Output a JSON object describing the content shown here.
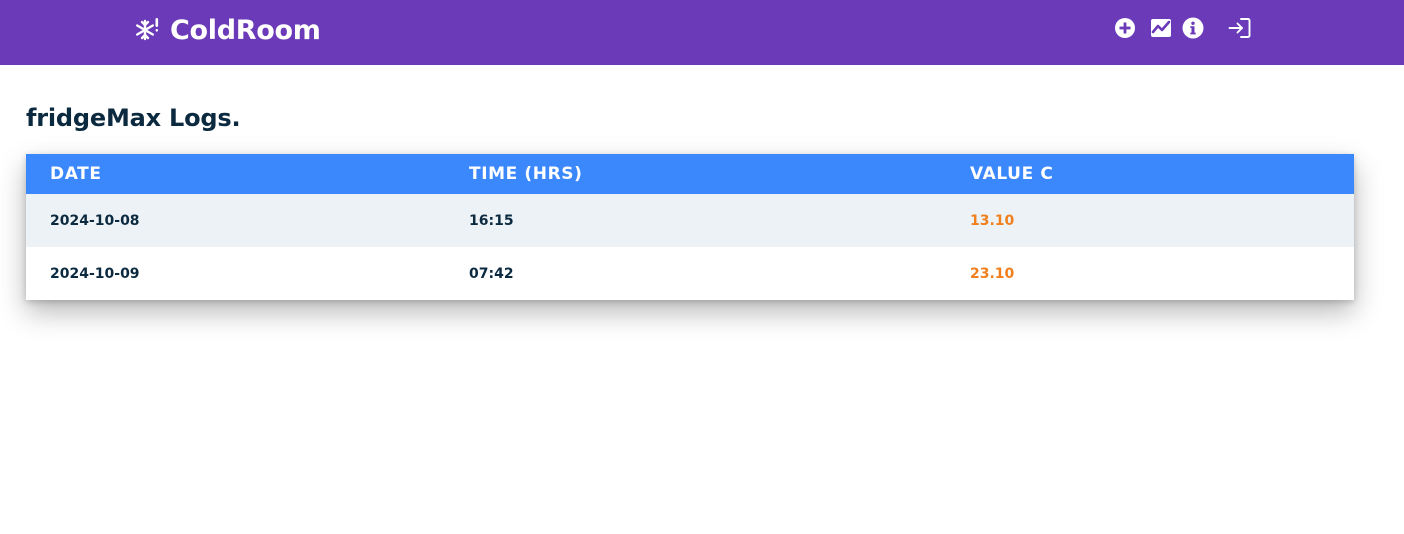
{
  "header": {
    "brand": "ColdRoom",
    "brand_icon": "snowflake-alert-icon",
    "background": "#6a3ab8",
    "icons": [
      "add-circle-icon",
      "chart-icon",
      "info-icon",
      "login-icon"
    ]
  },
  "page": {
    "title": "fridgeMax Logs."
  },
  "table": {
    "header_color": "#3b88fd",
    "value_color": "#f07f1e",
    "columns": [
      "DATE",
      "TIME (HRS)",
      "VALUE C"
    ],
    "rows": [
      {
        "date": "2024-10-08",
        "time": "16:15",
        "value": "13.10"
      },
      {
        "date": "2024-10-09",
        "time": "07:42",
        "value": "23.10"
      }
    ]
  }
}
